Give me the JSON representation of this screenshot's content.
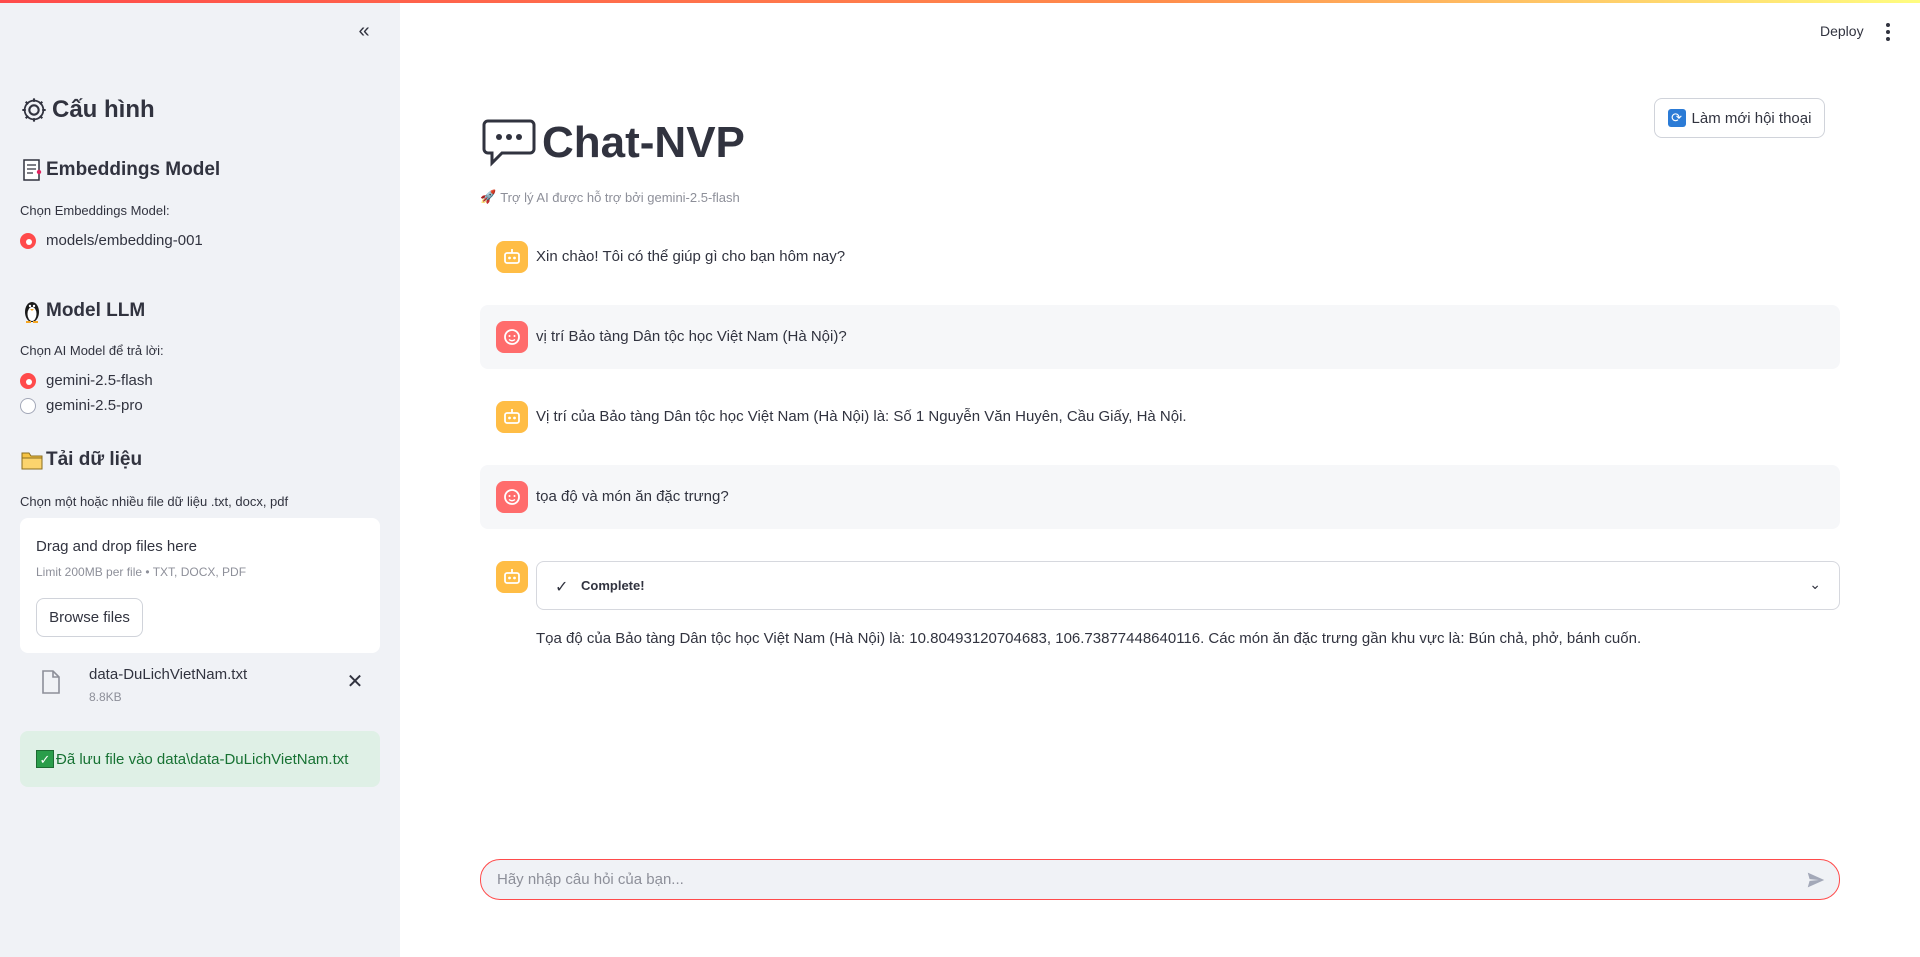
{
  "sidebar": {
    "config_title": "Cấu hình",
    "embeddings_heading": "Embeddings Model",
    "embeddings_label": "Chọn Embeddings Model:",
    "embeddings_options": [
      {
        "label": "models/embedding-001",
        "selected": true
      }
    ],
    "llm_heading": "Model LLM",
    "llm_label": "Chọn AI Model để trả lời:",
    "llm_options": [
      {
        "label": "gemini-2.5-flash",
        "selected": true
      },
      {
        "label": "gemini-2.5-pro",
        "selected": false
      }
    ],
    "upload_heading": "Tải dữ liệu",
    "upload_label": "Chọn một hoặc nhiều file dữ liệu .txt, docx, pdf",
    "dropzone": {
      "title": "Drag and drop files here",
      "limit": "Limit 200MB per file • TXT, DOCX, PDF",
      "browse_label": "Browse files"
    },
    "file": {
      "name": "data-DuLichVietNam.txt",
      "size": "8.8KB"
    },
    "success_message": "Đã lưu file vào data\\data-DuLichVietNam.txt"
  },
  "header": {
    "deploy_label": "Deploy"
  },
  "main": {
    "refresh_label": "Làm mới hội thoại",
    "title": "Chat-NVP",
    "subtitle": "Trợ lý AI được hỗ trợ bởi gemini-2.5-flash",
    "messages": [
      {
        "role": "assistant",
        "text": "Xin chào! Tôi có thể giúp gì cho bạn hôm nay?"
      },
      {
        "role": "user",
        "text": "vị trí Bảo tàng Dân tộc học Việt Nam (Hà Nội)?"
      },
      {
        "role": "assistant",
        "text": "Vị trí của Bảo tàng Dân tộc học Việt Nam (Hà Nội) là: Số 1 Nguyễn Văn Huyên, Cầu Giấy, Hà Nội."
      },
      {
        "role": "user",
        "text": "tọa độ và món ăn đặc trưng?"
      },
      {
        "role": "assistant",
        "status": "Complete!",
        "text": "Tọa độ của Bảo tàng Dân tộc học Việt Nam (Hà Nội) là: 10.80493120704683, 106.73877448640116. Các món ăn đặc trưng gần khu vực là: Bún chả, phở, bánh cuốn."
      }
    ],
    "chat_placeholder": "Hãy nhập câu hỏi của bạn..."
  },
  "colors": {
    "accent": "#ff4b4b",
    "bot_avatar": "#ffbd45",
    "user_avatar": "#ff6c6c",
    "success_bg": "#dff0e6",
    "success_text": "#177233"
  }
}
